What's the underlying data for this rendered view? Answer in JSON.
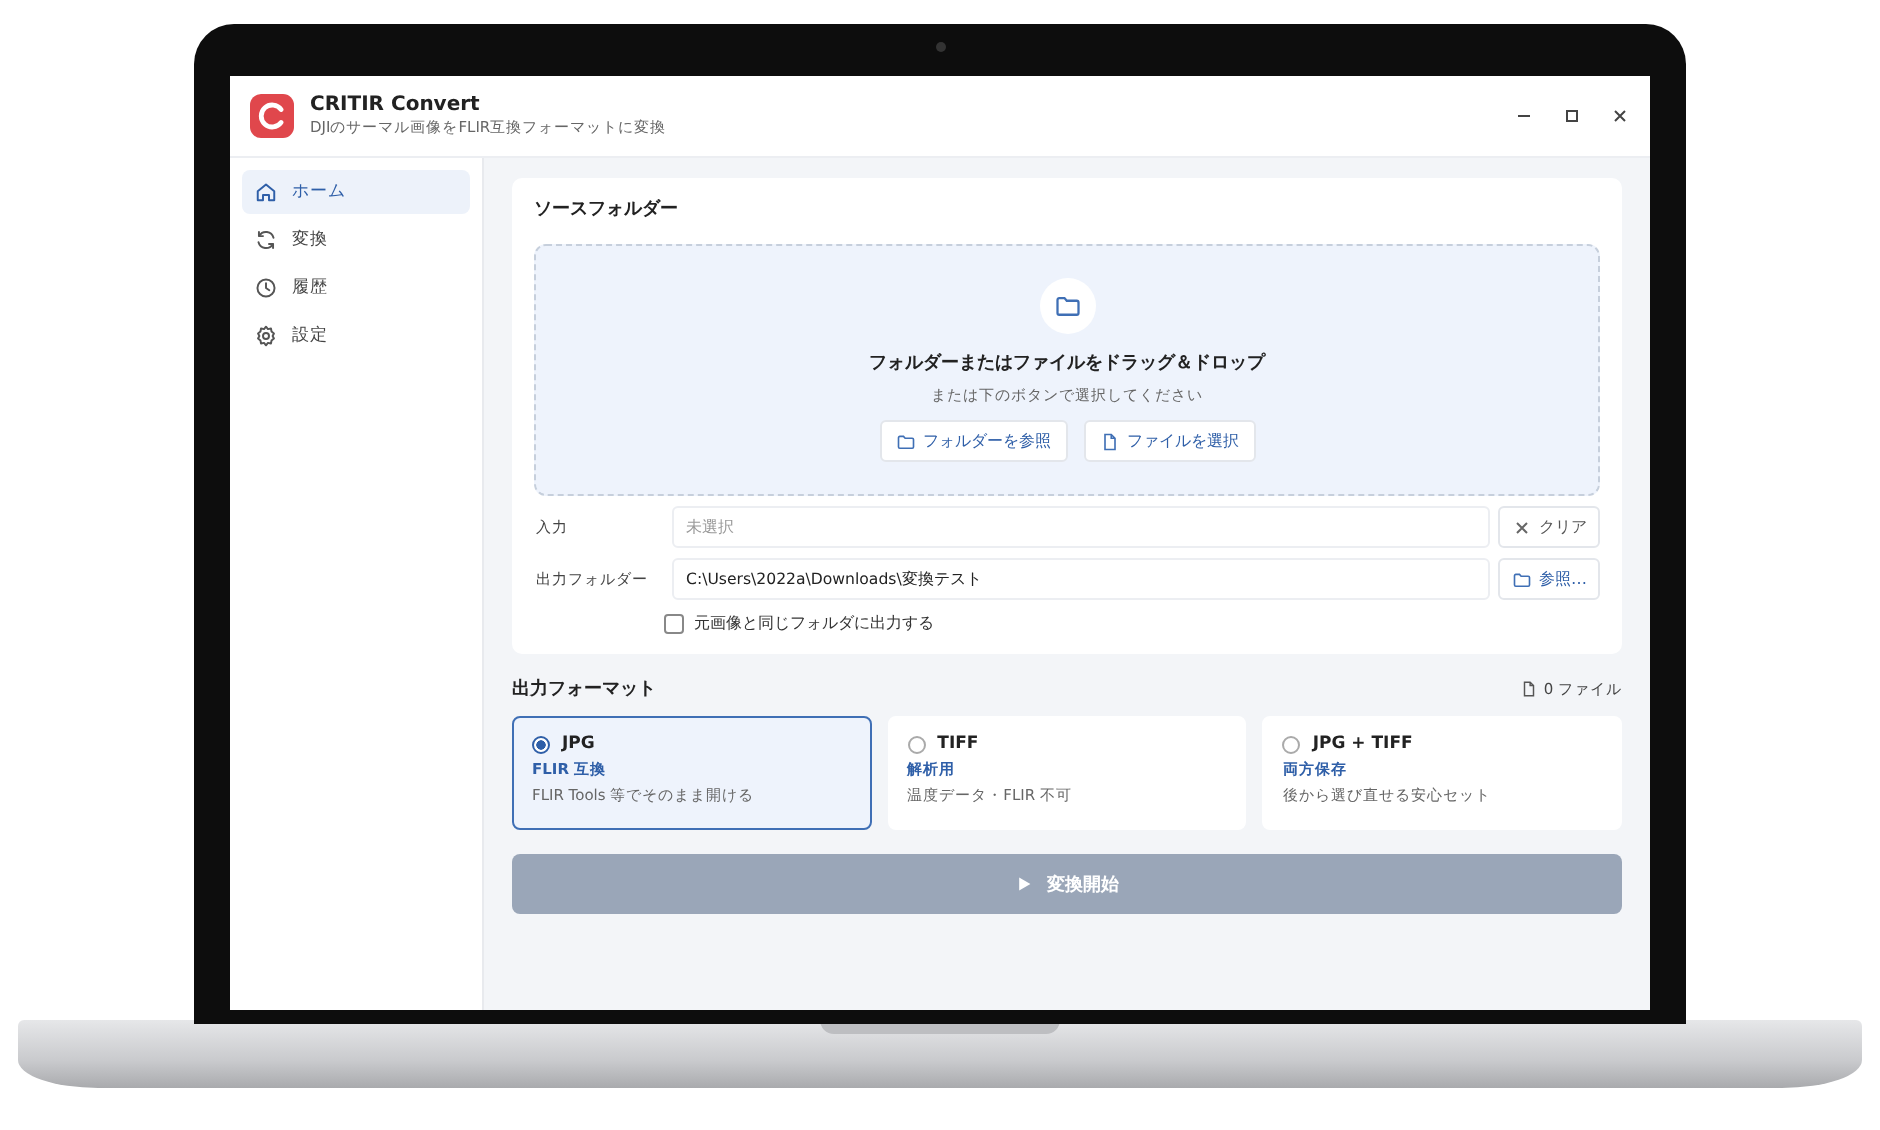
{
  "app": {
    "title": "CRITIR Convert",
    "subtitle": "DJIのサーマル画像をFLIR互換フォーマットに変換"
  },
  "sidebar": {
    "items": [
      {
        "label": "ホーム",
        "kind": "home",
        "selected": true
      },
      {
        "label": "変換",
        "kind": "convert",
        "selected": false
      },
      {
        "label": "履歴",
        "kind": "history",
        "selected": false
      },
      {
        "label": "設定",
        "kind": "settings",
        "selected": false
      }
    ]
  },
  "source_folder": {
    "title": "ソースフォルダー",
    "drop_title": "フォルダーまたはファイルをドラッグ＆ドロップ",
    "drop_hint": "または下のボタンで選択してください",
    "buttons": [
      {
        "label": "フォルダーを参照",
        "kind": "folder"
      },
      {
        "label": "ファイルを選択",
        "kind": "file"
      }
    ],
    "input": {
      "label": "入力",
      "placeholder": "未選択",
      "button": "クリア"
    },
    "output_folder": {
      "label": "出力フォルダー",
      "value": "C:\\Users\\2022a\\Downloads\\変換テスト",
      "button": "参照…"
    },
    "same_folder": {
      "label": "元画像と同じフォルダに出力する",
      "checked": false
    }
  },
  "output_format": {
    "title": "出力フォーマット",
    "file_count": "0 ファイル",
    "options": [
      {
        "name": "JPG",
        "tag": "FLIR 互換",
        "description": "FLIR Tools 等でそのまま開ける",
        "selected": true
      },
      {
        "name": "TIFF",
        "tag": "解析用",
        "description": "温度データ・FLIR 不可",
        "selected": false
      },
      {
        "name": "JPG + TIFF",
        "tag": "両方保存",
        "description": "後から選び直せる安心セット",
        "selected": false
      }
    ]
  },
  "start_button": {
    "label": "変換開始",
    "disabled": true
  }
}
